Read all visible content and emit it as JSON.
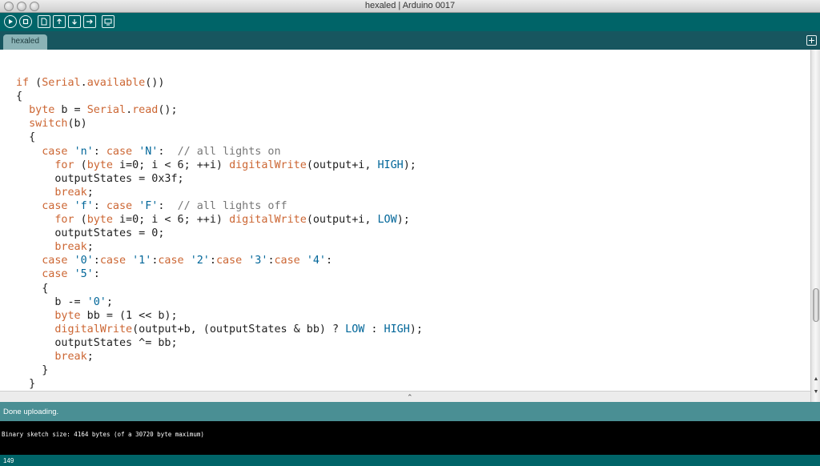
{
  "window": {
    "title": "hexaled | Arduino 0017"
  },
  "toolbar": {
    "buttons": [
      {
        "name": "verify",
        "icon": "play-icon"
      },
      {
        "name": "stop",
        "icon": "stop-icon"
      },
      {
        "name": "new",
        "icon": "new-file-icon"
      },
      {
        "name": "open",
        "icon": "open-icon"
      },
      {
        "name": "save",
        "icon": "save-icon"
      },
      {
        "name": "upload",
        "icon": "upload-icon"
      },
      {
        "name": "serial-monitor",
        "icon": "serial-monitor-icon"
      }
    ]
  },
  "tabs": [
    {
      "label": "hexaled"
    }
  ],
  "editor": {
    "lines": [
      "",
      "if (Serial.available())",
      "{",
      "  byte b = Serial.read();",
      "  switch(b)",
      "  {",
      "    case 'n': case 'N':  // all lights on",
      "      for (byte i=0; i < 6; ++i) digitalWrite(output+i, HIGH);",
      "      outputStates = 0x3f;",
      "      break;",
      "    case 'f': case 'F':  // all lights off",
      "      for (byte i=0; i < 6; ++i) digitalWrite(output+i, LOW);",
      "      outputStates = 0;",
      "      break;",
      "    case '0':case '1':case '2':case '3':case '4':",
      "    case '5':",
      "    {",
      "      b -= '0';",
      "      byte bb = (1 << b);",
      "      digitalWrite(output+b, (outputStates & bb) ? LOW : HIGH);",
      "      outputStates ^= bb;",
      "      break;",
      "    }",
      "  }"
    ]
  },
  "status": {
    "message": "Done uploading."
  },
  "console": {
    "output": "Binary sketch size: 4164 bytes (of a 30720 byte maximum)"
  },
  "footer": {
    "line_number": "149"
  },
  "colors": {
    "toolbar": "#006468",
    "tabbar": "#17565f",
    "status": "#4a8f94",
    "keyword": "#cc6633",
    "constant": "#006699",
    "comment": "#777777"
  }
}
